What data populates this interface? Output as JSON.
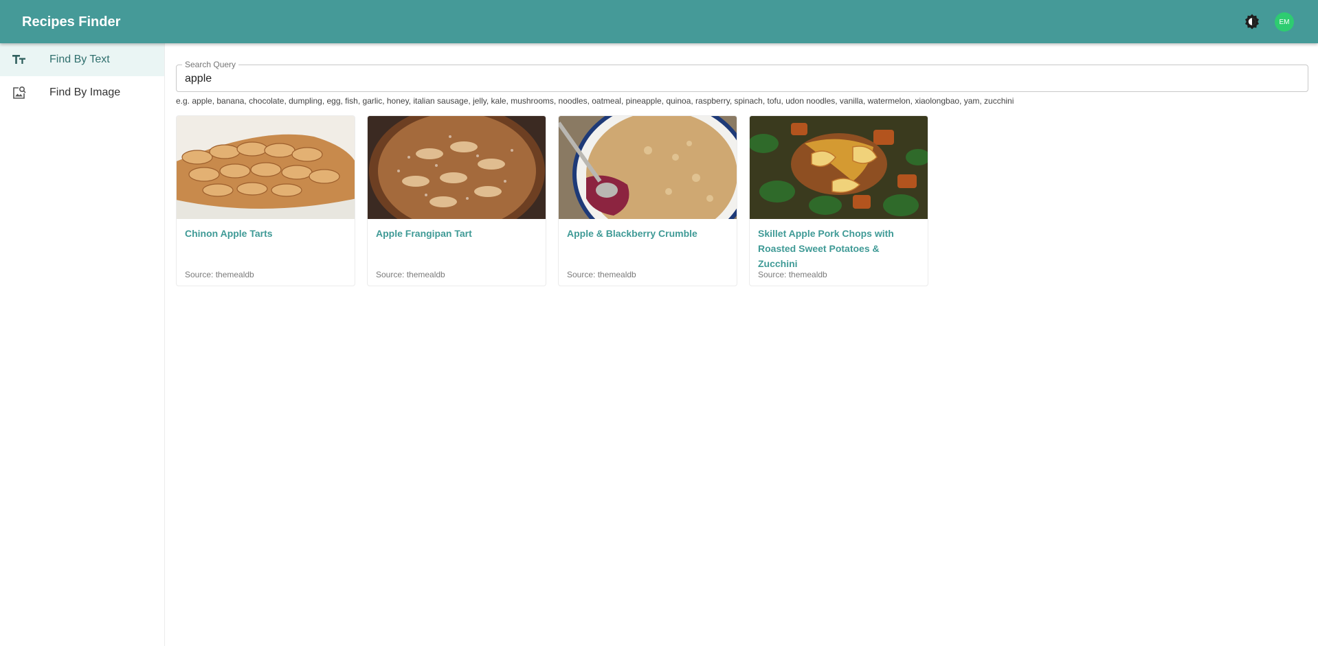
{
  "app": {
    "title": "Recipes Finder",
    "accent_color": "#459a98",
    "theme_toggle_icon": "brightness-icon",
    "avatar_initials": "EM",
    "avatar_color": "#2ecc71"
  },
  "sidebar": {
    "items": [
      {
        "label": "Find By Text",
        "icon": "text-fields-icon",
        "active": true
      },
      {
        "label": "Find By Image",
        "icon": "image-search-icon",
        "active": false
      }
    ]
  },
  "search": {
    "label": "Search Query",
    "value": "apple",
    "hint": "e.g. apple, banana, chocolate, dumpling, egg, fish, garlic, honey, italian sausage, jelly, kale, mushrooms, noodles, oatmeal, pineapple, quinoa, raspberry, spinach, tofu, udon noodles, vanilla, watermelon, xiaolongbao, yam, zucchini"
  },
  "results": [
    {
      "title": "Chinon Apple Tarts",
      "source": "Source: themealdb"
    },
    {
      "title": "Apple Frangipan Tart",
      "source": "Source: themealdb"
    },
    {
      "title": "Apple & Blackberry Crumble",
      "source": "Source: themealdb"
    },
    {
      "title": "Skillet Apple Pork Chops with Roasted Sweet Potatoes & Zucchini",
      "source": "Source: themealdb"
    }
  ]
}
